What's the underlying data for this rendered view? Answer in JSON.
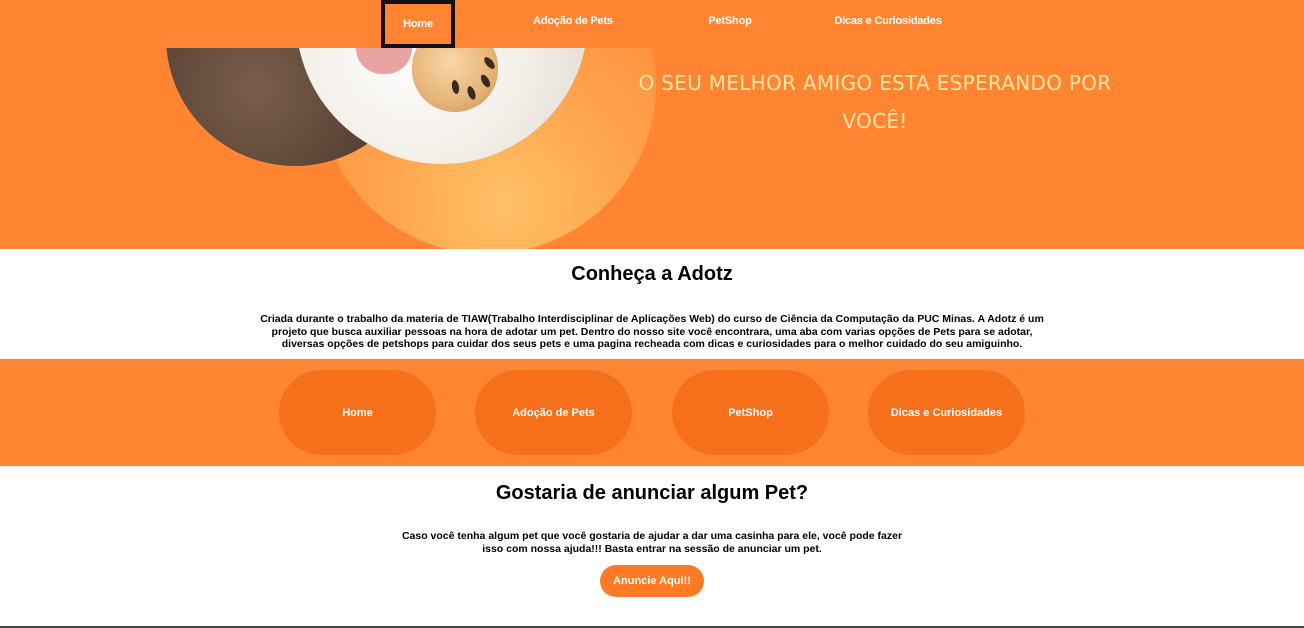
{
  "nav": {
    "items": [
      {
        "label": "Home",
        "active": true
      },
      {
        "label": "Adoção de Pets",
        "active": false
      },
      {
        "label": "PetShop",
        "active": false
      },
      {
        "label": "Dicas e Curiosidades",
        "active": false
      }
    ]
  },
  "hero": {
    "title": "O SEU MELHOR AMIGO ESTA ESPERANDO POR VOCÊ!"
  },
  "about": {
    "title": "Conheça a Adotz",
    "text": "Criada durante o trabalho da materia de TIAW(Trabalho Interdisciplinar de Aplicações Web) do curso de Ciência da Computação da PUC Minas. A Adotz é um projeto que busca auxiliar pessoas na hora de adotar um pet. Dentro do nosso site você encontrara, uma aba com varias opções de Pets para se adotar, diversas opções de petshops para cuidar dos seus pets e uma pagina recheada com dicas e curiosidades para o melhor cuidado do seu amiguinho."
  },
  "quicknav": {
    "items": [
      {
        "label": "Home"
      },
      {
        "label": "Adoção de Pets"
      },
      {
        "label": "PetShop"
      },
      {
        "label": "Dicas e Curiosidades"
      }
    ]
  },
  "announce": {
    "title": "Gostaria de anunciar algum Pet?",
    "text": "Caso você tenha algum pet que você gostaria de ajudar a dar uma casinha para ele, você pode fazer isso com nossa ajuda!!! Basta entrar na sessão de anunciar um pet.",
    "button_label": "Anuncie Aqui!!"
  },
  "colors": {
    "brand_orange": "#ff8533",
    "pill_orange": "#f6701c",
    "hero_text": "#ffe6a3"
  }
}
